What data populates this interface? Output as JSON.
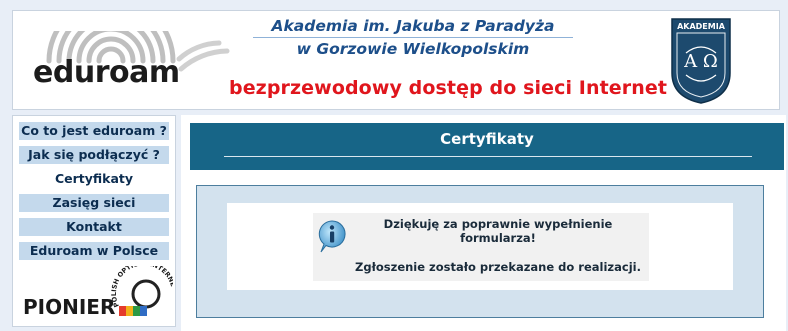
{
  "header": {
    "logo_text_edu": "edu",
    "logo_text_roam": "roam",
    "university_line1": "Akademia im. Jakuba z Paradyża",
    "university_line2": "w Gorzowie Wielkopolskim",
    "tagline": "bezprzewodowy dostęp do sieci Internet",
    "crest_label": "AKADEMIA",
    "crest_letters": "A Ω",
    "colors": {
      "tagline": "#e0161d",
      "university": "#1d4f8a",
      "crest": "#1d4a6e"
    }
  },
  "sidebar": {
    "items": [
      {
        "label": "Co to jest eduroam ?",
        "active": false
      },
      {
        "label": "Jak się podłączyć ?",
        "active": false
      },
      {
        "label": "Certyfikaty",
        "active": true
      },
      {
        "label": "Zasięg sieci",
        "active": false
      },
      {
        "label": "Kontakt",
        "active": false
      },
      {
        "label": "Eduroam w Polsce",
        "active": false
      }
    ],
    "pionier": {
      "name": "PIONIER",
      "arc_text": "POLISH OPTICAL INTERNET"
    }
  },
  "main": {
    "title": "Certyfikaty",
    "message": {
      "icon": "info-icon",
      "line1": "Dziękuję za poprawnie wypełnienie formularza!",
      "line2": "Zgłoszenie zostało przekazane do realizacji."
    },
    "colors": {
      "title_bar": "#176587",
      "panel": "#d3e2ee"
    }
  }
}
